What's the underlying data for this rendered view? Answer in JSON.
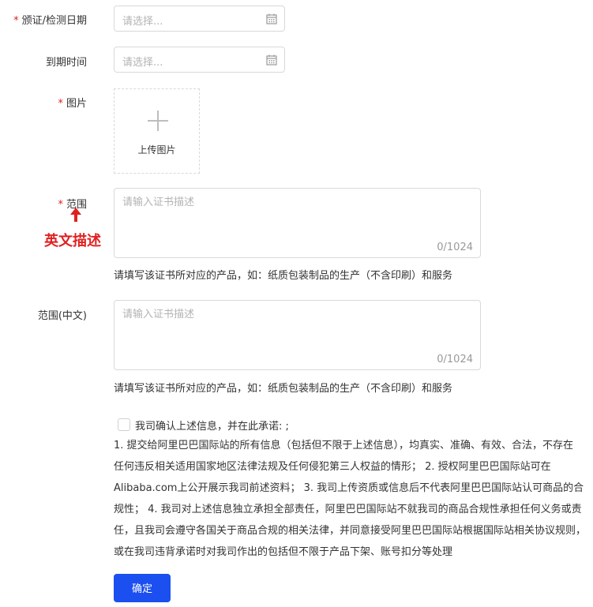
{
  "form": {
    "issue_date": {
      "label": "颁证/检测日期",
      "placeholder": "请选择..."
    },
    "expire_date": {
      "label": "到期时间",
      "placeholder": "请选择..."
    },
    "image": {
      "label": "图片",
      "upload_text": "上传图片"
    },
    "scope_en": {
      "label": "范围",
      "placeholder": "请输入证书描述",
      "counter": "0/1024",
      "help": "请填写该证书所对应的产品，如：纸质包装制品的生产（不含印刷）和服务",
      "annotation": "英文描述"
    },
    "scope_cn": {
      "label": "范围(中文)",
      "placeholder": "请输入证书描述",
      "counter": "0/1024",
      "help": "请填写该证书所对应的产品，如：纸质包装制品的生产（不含印刷）和服务"
    },
    "commitment": {
      "checkbox_label": "我司确认上述信息，并在此承诺: ;",
      "lines": [
        "1. 提交给阿里巴巴国际站的所有信息（包括但不限于上述信息），均真实、准确、有效、合法，不存在",
        "任何违反相关适用国家地区法律法规及任何侵犯第三人权益的情形； 2. 授权阿里巴巴国际站可在",
        "Alibaba.com上公开展示我司前述资料； 3. 我司上传资质或信息后不代表阿里巴巴国际站认可商品的合",
        "规性； 4. 我司对上述信息独立承担全部责任，阿里巴巴国际站不就我司的商品合规性承担任何义务或责",
        "任，且我司会遵守各国关于商品合规的相关法律，并同意接受阿里巴巴国际站根据国际站相关协议规则，",
        "或在我司违背承诺时对我司作出的包括但不限于产品下架、账号扣分等处理"
      ]
    },
    "submit_label": "确定",
    "required_mark": "*"
  },
  "icons": [
    "calendar-icon",
    "plus-icon",
    "arrow-up-icon"
  ],
  "colors": {
    "required": "#e02020",
    "primary_button": "#1c4ff0",
    "annotation": "#e02020"
  }
}
